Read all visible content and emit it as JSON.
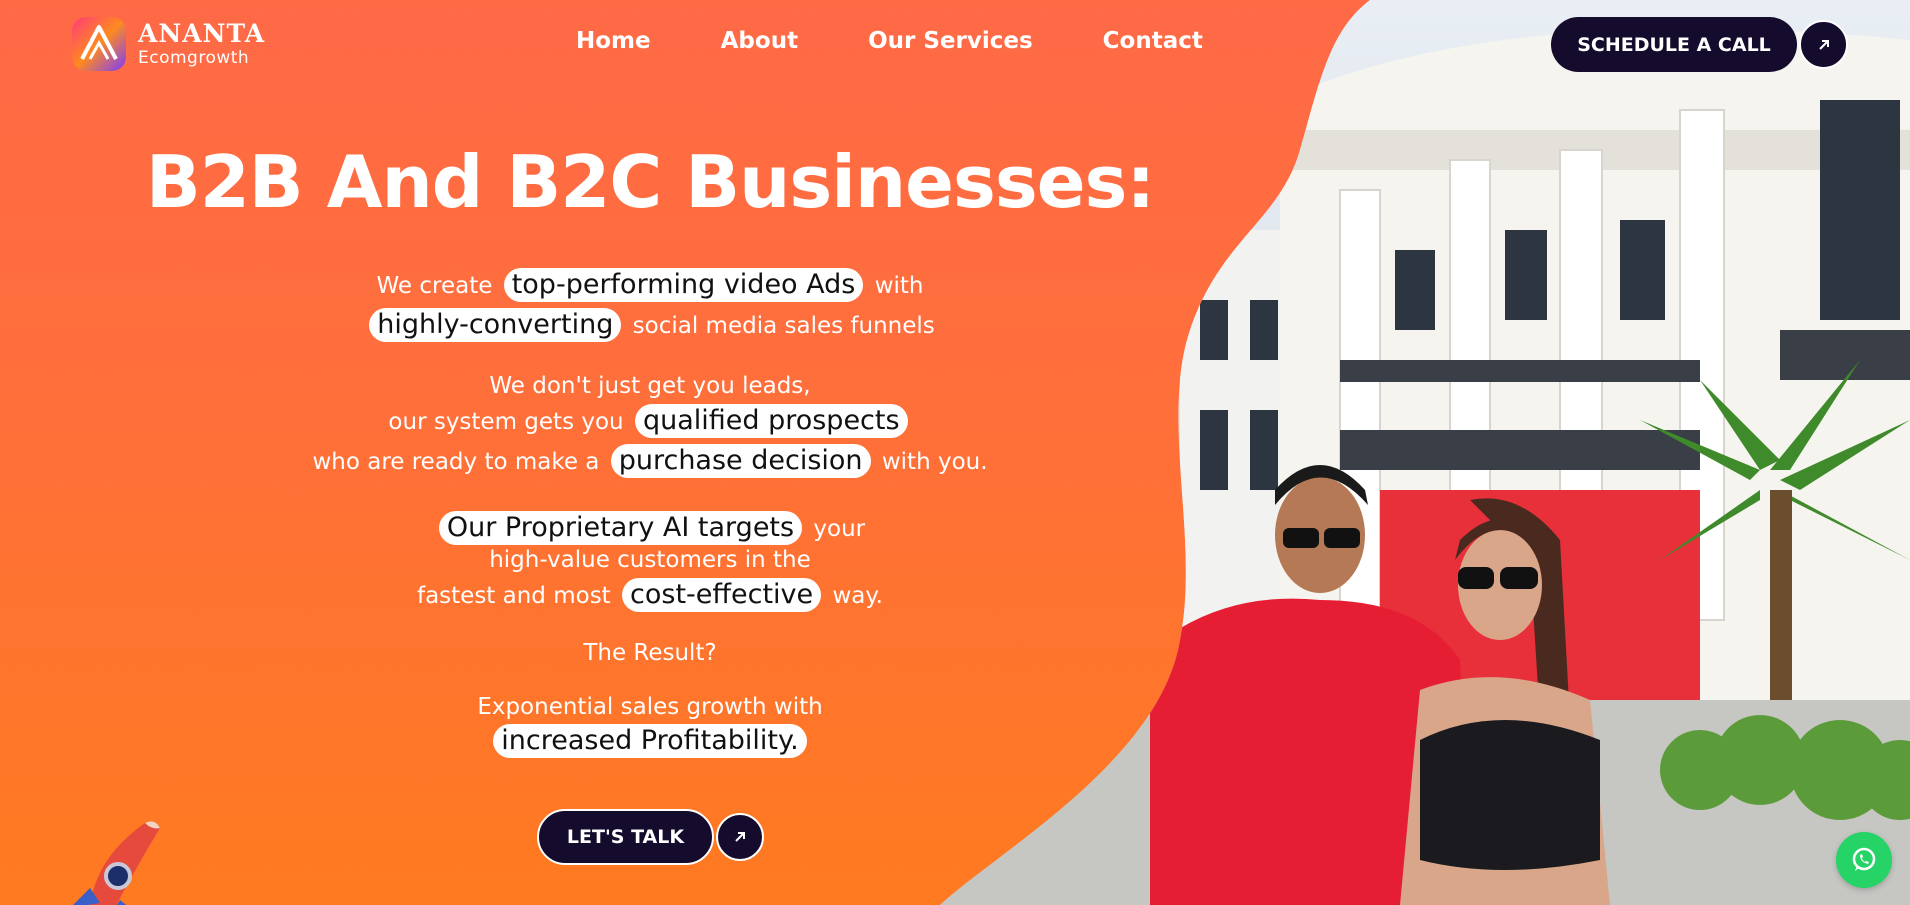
{
  "brand": {
    "name": "ANANTA",
    "sub": "Ecomgrowth"
  },
  "nav": {
    "items": [
      "Home",
      "About",
      "Our Services",
      "Contact"
    ]
  },
  "header_cta": {
    "label": "SCHEDULE A CALL"
  },
  "hero": {
    "title": "B2B And B2C Businesses:",
    "l1_pre": "We create",
    "l1_pill": "top-performing video Ads",
    "l1_post": "with",
    "l2_pill": "highly-converting",
    "l2_post": "social media sales funnels",
    "l3": "We don't just get you leads,",
    "l4_pre": "our system gets you",
    "l4_pill": "qualified prospects",
    "l5_pre": "who are ready to make a",
    "l5_pill": "purchase decision",
    "l5_post": "with you.",
    "l6_pill": "Our Proprietary AI targets",
    "l6_post": "your",
    "l7": "high-value customers in the",
    "l8_pre": "fastest and most",
    "l8_pill": "cost-effective",
    "l8_post": "way.",
    "l9": "The Result?",
    "l10": "Exponential sales growth with",
    "l11_pill": "increased Profitability."
  },
  "bottom_cta": {
    "label": "LET'S TALK"
  },
  "colors": {
    "accent": "#ff6a47",
    "dark": "#140b2d",
    "whatsapp": "#25d366"
  },
  "icons": [
    "ananta-logo-icon",
    "arrow-up-right-icon",
    "rocket-icon",
    "whatsapp-icon"
  ]
}
